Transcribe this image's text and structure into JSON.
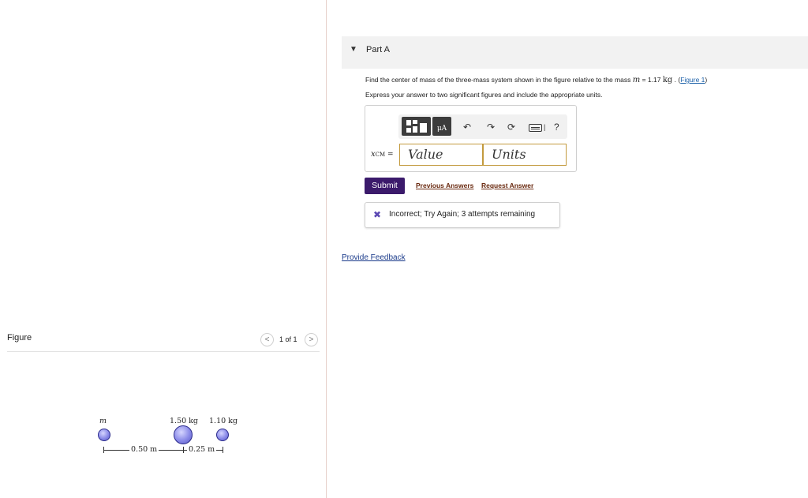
{
  "part": {
    "toggle_icon": "triangle-down-icon",
    "title": "Part A"
  },
  "question": {
    "text_before": "Find the center of mass of the three-mass system shown in the figure relative to the mass ",
    "variable": "m",
    "equals": " = 1.17 ",
    "unit": "kg",
    "text_after": " . (",
    "figure_link": "Figure 1",
    "close_paren": ")"
  },
  "instruction": "Express your answer to two significant figures and include the appropriate units.",
  "answer": {
    "label_var": "x",
    "label_sub": "CM",
    "label_eq": " =",
    "value_placeholder": "Value",
    "units_placeholder": "Units",
    "toolbar": {
      "templates_icon": "templates-icon",
      "units_icon_text": "μA",
      "undo_icon": "undo-icon",
      "redo_icon": "redo-icon",
      "reset_icon": "reset-icon",
      "keyboard_icon": "keyboard-icon",
      "caret": "|",
      "help": "?"
    }
  },
  "actions": {
    "submit": "Submit",
    "previous_answers": "Previous Answers",
    "request_answer": "Request Answer"
  },
  "feedback": {
    "icon": "x-mark-icon",
    "text": "Incorrect; Try Again; 3 attempts remaining"
  },
  "provide_feedback": "Provide Feedback",
  "figure": {
    "title": "Figure",
    "prev": "<",
    "next": ">",
    "page_count": "1 of 1",
    "masses": [
      {
        "label": "m"
      },
      {
        "label": "1.50 kg"
      },
      {
        "label": "1.10 kg"
      }
    ],
    "dimensions": [
      "0.50 m",
      "0.25 m"
    ],
    "colors": {
      "ball": "#8a8ae8",
      "accent": "#3b1a6b"
    }
  }
}
